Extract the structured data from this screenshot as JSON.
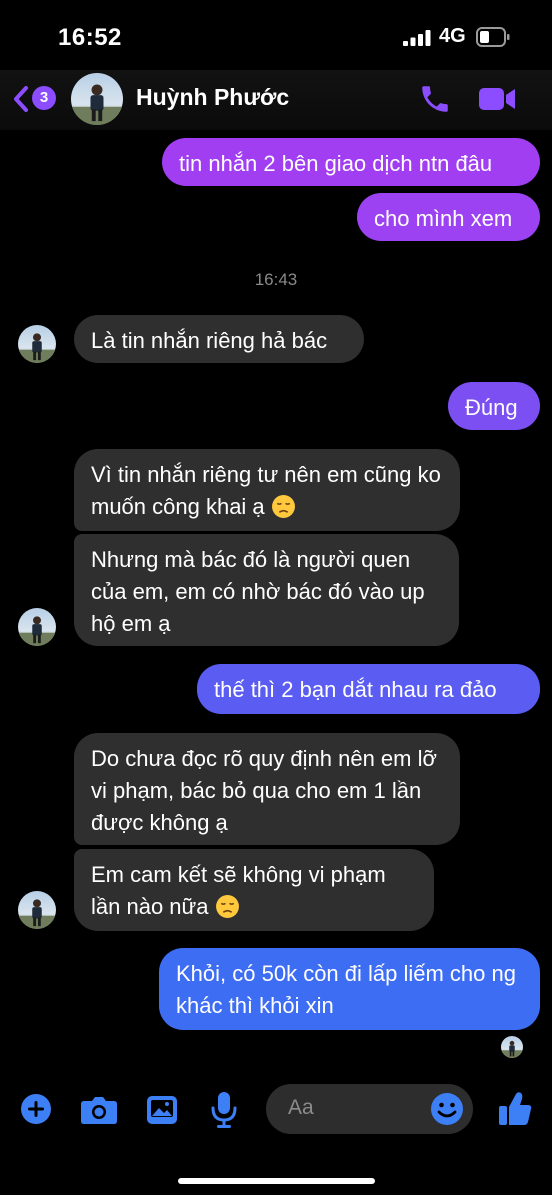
{
  "status": {
    "time": "16:52",
    "network": "4G"
  },
  "header": {
    "back_count": "3",
    "contact_name": "Huỳnh Phước"
  },
  "messages": [
    {
      "side": "out",
      "text": "tin nhắn 2 bên giao dịch ntn đâu"
    },
    {
      "side": "out",
      "text": "cho mình xem"
    },
    {
      "side": "in",
      "text": "Là tin nhắn riêng hả bác"
    },
    {
      "side": "out",
      "text": "Đúng"
    },
    {
      "side": "in",
      "text": "Vì tin nhắn riêng tư nên em cũng ko muốn công khai ạ",
      "emoji": "disappointed-face"
    },
    {
      "side": "in",
      "text": "Nhưng mà bác đó là người quen của em, em có nhờ bác đó vào up hộ em ạ"
    },
    {
      "side": "out",
      "text": "thế thì 2 bạn dắt nhau ra đảo"
    },
    {
      "side": "in",
      "text": "Do chưa đọc rõ quy định nên em lỡ vi phạm, bác bỏ qua cho em 1 lần được không ạ"
    },
    {
      "side": "in",
      "text": "Em cam kết sẽ không vi phạm lần nào nữa",
      "emoji": "disappointed-face"
    },
    {
      "side": "out",
      "text": "Khỏi, có 50k còn đi lấp liếm cho ng khác thì khỏi xin"
    }
  ],
  "timestamp": "16:43",
  "composer": {
    "placeholder": "Aa"
  },
  "colors": {
    "accent": "#8b4dff",
    "outgoing_top": "#9b3ff2",
    "outgoing_bottom": "#3f6df2",
    "incoming": "#2f2f2f",
    "composer_icon": "#3d7ff5"
  },
  "icons": [
    "back-chevron-icon",
    "phone-icon",
    "video-camera-icon",
    "plus-icon",
    "camera-icon",
    "gallery-icon",
    "microphone-icon",
    "emoji-icon",
    "thumbs-up-icon"
  ]
}
